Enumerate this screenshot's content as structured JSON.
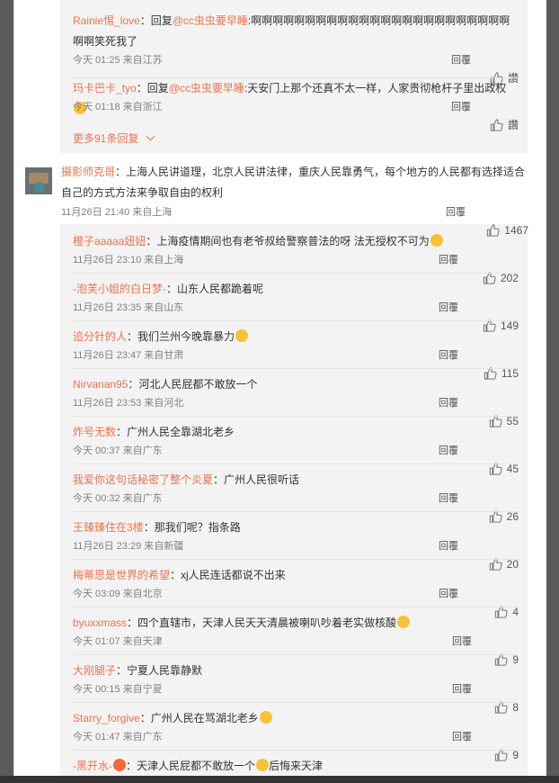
{
  "replies_prev": [
    {
      "name": "Rainie惕_love",
      "mention": "@cc虫虫要早睡",
      "text": ":啊啊啊啊啊啊啊啊啊啊啊啊啊啊啊啊啊啊啊啊啊啊啊啊啊啊笑死我了",
      "meta": "今天 01:25 来自江苏",
      "reply": "回覆",
      "like": "讚"
    },
    {
      "name": "玛卡巴卡_tyo",
      "mention": "@cc虫虫要早睡",
      "text": ":天安门上那个还真不太一样，人家贵彻枪杆子里出政权",
      "meta": "今天 01:18 来自浙江",
      "reply": "回覆",
      "like": "讚"
    }
  ],
  "more_replies": "更多91条回复",
  "comment": {
    "name": "摄影师克哥",
    "text": "：上海人民讲道理，北京人民讲法律，重庆人民靠勇气，每个地方的人民都有选择适合自己的方式方法来争取自由的权利",
    "meta": "11月26日 21:40 来自上海",
    "reply": "回覆",
    "like": "1467"
  },
  "replies": [
    {
      "name": "橙子aaaaa妞妞",
      "text": "：上海疫情期间也有老爷叔给警察普法的呀 法无授权不可为",
      "meta": "11月26日 23:10 来自上海",
      "reply": "回覆",
      "like": "202"
    },
    {
      "name": "-泡芙小姐的白日梦-",
      "text": "：山东人民都跪着呢",
      "meta": "11月26日 23:35 来自山东",
      "reply": "回覆",
      "like": "149"
    },
    {
      "name": "追分针的人",
      "text": "：我们兰州今晚靠暴力",
      "meta": "11月26日 23:47 来自甘肃",
      "reply": "回覆",
      "like": "115"
    },
    {
      "name": "Nirvanan95",
      "text": "：河北人民屁都不敢放一个",
      "meta": "11月26日 23:53 来自河北",
      "reply": "回覆",
      "like": "55"
    },
    {
      "name": "炸号无数",
      "text": "：广州人民全靠湖北老乡",
      "meta": "今天 00:37 来自广东",
      "reply": "回覆",
      "like": "45"
    },
    {
      "name": "我爱你这句话秘密了整个炎夏",
      "text": "：广州人民很听话",
      "meta": "今天 00:32 来自广东",
      "reply": "回覆",
      "like": "26"
    },
    {
      "name": "王臻臻住在3楼",
      "text": "：那我们呢？指条路",
      "meta": "11月26日 23:29 来自新疆",
      "reply": "回覆",
      "like": "20"
    },
    {
      "name": "梅蒂思是世界的希望",
      "text": "：xj人民连话都说不出来",
      "meta": "今天 03:09 来自北京",
      "reply": "回覆",
      "like": "4"
    },
    {
      "name": "byuxxmass",
      "text": "：四个直辖市，天津人民天天清晨被喇叭吵着老实做核酸",
      "meta": "今天 01:07 来自天津",
      "reply": "回覆",
      "like": "9"
    },
    {
      "name": "大刚腿子",
      "text": "：宁夏人民靠静默",
      "meta": "今天 00:15 来自宁夏",
      "reply": "回覆",
      "like": "8"
    },
    {
      "name": "Starry_forgive",
      "text": "：广州人民在骂湖北老乡",
      "meta": "今天 01:47 来自广东",
      "reply": "回覆",
      "like": "9"
    },
    {
      "name": "-黑开水-",
      "text": "：天津人民屁都不敢放一个",
      "text2": "后悔来天津",
      "meta": "",
      "reply": "",
      "like": ""
    }
  ]
}
